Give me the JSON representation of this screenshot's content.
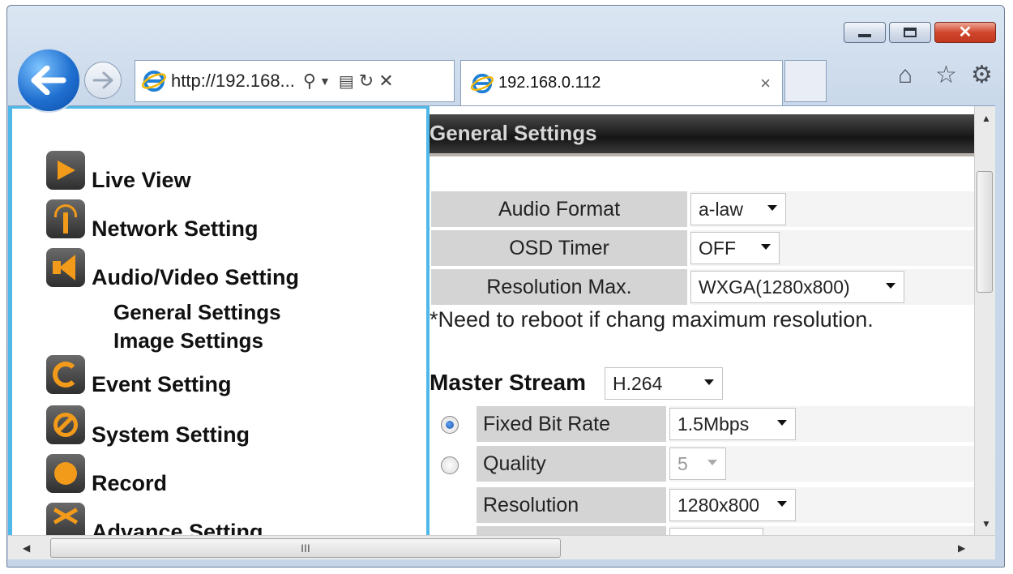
{
  "browser": {
    "address_url": "http://192.168...",
    "search_icon": "magnifier-icon",
    "tab_title": "192.168.0.112",
    "tab_close": "×",
    "toolbar_icons": [
      "home-icon",
      "star-icon",
      "gear-icon"
    ]
  },
  "sidebar": {
    "items": [
      {
        "label": "Live View",
        "icon": "play-icon"
      },
      {
        "label": "Network Setting",
        "icon": "antenna-icon"
      },
      {
        "label": "Audio/Video Setting",
        "icon": "speaker-icon"
      },
      {
        "label": "Event Setting",
        "icon": "swirl-icon"
      },
      {
        "label": "System Setting",
        "icon": "wrench-icon"
      },
      {
        "label": "Record",
        "icon": "record-icon"
      },
      {
        "label": "Advance Setting",
        "icon": "shuffle-icon"
      }
    ],
    "subitems": [
      "General Settings",
      "Image Settings"
    ]
  },
  "main": {
    "header": "General Settings",
    "rows": [
      {
        "label": "Audio Format",
        "value": "a-law"
      },
      {
        "label": "OSD Timer",
        "value": "OFF"
      },
      {
        "label": "Resolution Max.",
        "value": "WXGA(1280x800)"
      }
    ],
    "note": "*Need to reboot if chang maximum resolution.",
    "master_stream_label": "Master Stream",
    "master_stream_value": "H.264",
    "stream_rows": [
      {
        "label": "Fixed Bit Rate",
        "value": "1.5Mbps",
        "radio": "selected"
      },
      {
        "label": "Quality",
        "value": "5",
        "radio": "unselected",
        "disabled": true
      },
      {
        "label": "Resolution",
        "value": "1280x800"
      },
      {
        "label": "",
        "value": ""
      }
    ]
  },
  "scrollbar": {
    "hthumb_grip": "III"
  }
}
